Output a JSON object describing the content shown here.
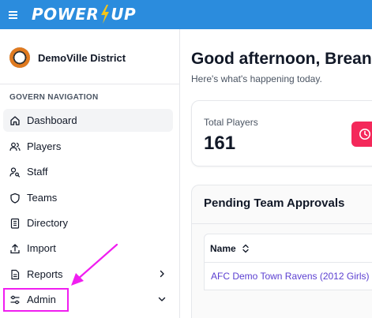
{
  "app": {
    "logo_text_left": "POWER",
    "logo_text_right": "UP",
    "brand_color": "#2b8cdd",
    "accent_bolt_color": "#f5c518"
  },
  "sidebar": {
    "org_name": "DemoVille District",
    "section_header": "GOVERN NAVIGATION",
    "items": [
      {
        "label": "Dashboard",
        "icon": "home-icon",
        "active": true
      },
      {
        "label": "Players",
        "icon": "users-icon"
      },
      {
        "label": "Staff",
        "icon": "user-search-icon"
      },
      {
        "label": "Teams",
        "icon": "shield-icon"
      },
      {
        "label": "Directory",
        "icon": "building-icon"
      },
      {
        "label": "Import",
        "icon": "upload-icon"
      },
      {
        "label": "Reports",
        "icon": "file-icon",
        "chevron": "chevron-right-icon"
      },
      {
        "label": "Admin",
        "icon": "sliders-icon",
        "chevron": "chevron-down-icon"
      }
    ]
  },
  "main": {
    "greeting": "Good afternoon, Breanna",
    "subgreeting": "Here's what's happening today.",
    "stat": {
      "label": "Total Players",
      "value": "161",
      "icon": "clock-icon",
      "icon_bg": "#f4285a"
    },
    "approvals": {
      "title": "Pending Team Approvals",
      "column_header": "Name",
      "rows": [
        "AFC Demo Town Ravens (2012 Girls)"
      ]
    }
  },
  "annotation": {
    "highlight_color": "#f01ef0"
  }
}
